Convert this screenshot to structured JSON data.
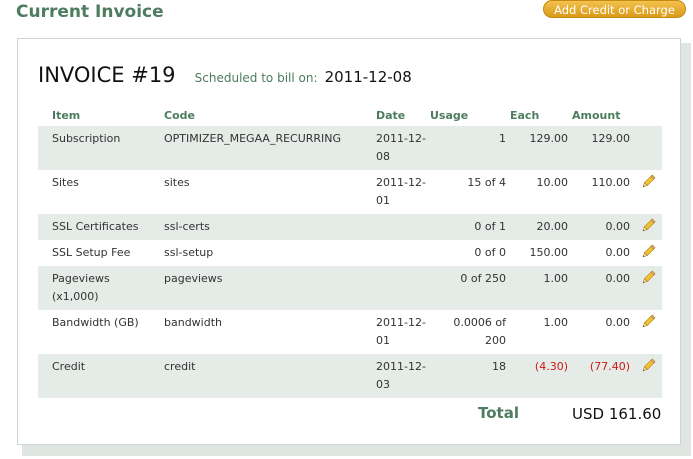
{
  "header": {
    "title": "Current Invoice",
    "add_credit_label": "Add Credit or Charge"
  },
  "invoice": {
    "number": "INVOICE #19",
    "schedule_label": "Scheduled to bill on:",
    "schedule_date": "2011-12-08"
  },
  "table": {
    "columns": {
      "item": "Item",
      "code": "Code",
      "date": "Date",
      "usage": "Usage",
      "each": "Each",
      "amount": "Amount"
    },
    "rows": [
      {
        "item": "Subscription",
        "code": "OPTIMIZER_MEGAA_RECURRING",
        "date": "2011-12-08",
        "usage": "1",
        "each": "129.00",
        "amount": "129.00",
        "editable": false
      },
      {
        "item": "Sites",
        "code": "sites",
        "date": "2011-12-01",
        "usage": "15 of 4",
        "each": "10.00",
        "amount": "110.00",
        "editable": true
      },
      {
        "item": "SSL Certificates",
        "code": "ssl-certs",
        "date": "",
        "usage": "0 of 1",
        "each": "20.00",
        "amount": "0.00",
        "editable": true
      },
      {
        "item": "SSL Setup Fee",
        "code": "ssl-setup",
        "date": "",
        "usage": "0 of 0",
        "each": "150.00",
        "amount": "0.00",
        "editable": true
      },
      {
        "item": "Pageviews (x1,000)",
        "code": "pageviews",
        "date": "",
        "usage": "0 of 250",
        "each": "1.00",
        "amount": "0.00",
        "editable": true
      },
      {
        "item": "Bandwidth (GB)",
        "code": "bandwidth",
        "date": "2011-12-01",
        "usage": "0.0006 of 200",
        "each": "1.00",
        "amount": "0.00",
        "editable": true
      },
      {
        "item": "Credit",
        "code": "credit",
        "date": "2011-12-03",
        "usage": "18",
        "each": "(4.30)",
        "amount": "(77.40)",
        "editable": true,
        "negative": true
      }
    ]
  },
  "total": {
    "label": "Total",
    "value": "USD 161.60"
  },
  "colors": {
    "accent_green": "#4d7c5e",
    "row_shade": "#e5ebe7",
    "negative_red": "#d01818",
    "button_orange": "#e0a52a"
  },
  "icons": {
    "edit": "pencil-icon"
  }
}
